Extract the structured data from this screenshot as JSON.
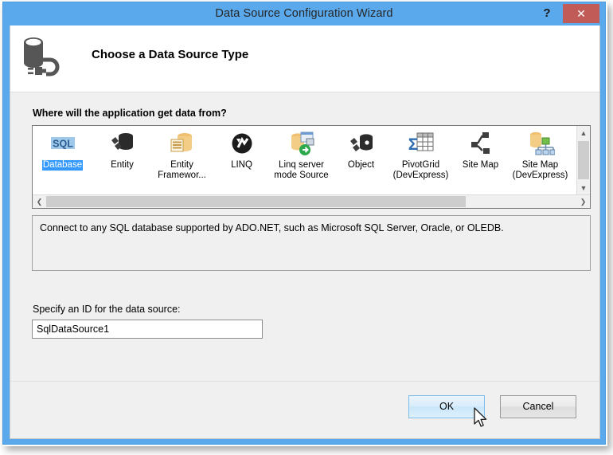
{
  "window": {
    "title": "Data Source Configuration Wizard",
    "help_label": "?",
    "close_label": "✕",
    "titlebar_color": "#5aa9ec",
    "close_color": "#c15b57"
  },
  "header": {
    "title": "Choose a Data Source Type",
    "icon": "database-plug-icon"
  },
  "body": {
    "where_label": "Where will the application get data from?",
    "specify_label": "Specify an ID for the data source:",
    "description": "Connect to any SQL database supported by ADO.NET, such as Microsoft SQL Server, Oracle, or OLEDB.",
    "selection_color": "#3399ff"
  },
  "data_source_types": [
    {
      "label": "Database",
      "icon": "sql-database-icon",
      "selected": true
    },
    {
      "label": "Entity",
      "icon": "entity-icon",
      "selected": false
    },
    {
      "label": "Entity Framewor...",
      "icon": "entity-framework-icon",
      "selected": false
    },
    {
      "label": "LINQ",
      "icon": "linq-icon",
      "selected": false
    },
    {
      "label": "Linq server mode Source",
      "icon": "linq-server-mode-icon",
      "selected": false
    },
    {
      "label": "Object",
      "icon": "object-icon",
      "selected": false
    },
    {
      "label": "PivotGrid (DevExpress)",
      "icon": "pivotgrid-icon",
      "selected": false
    },
    {
      "label": "Site Map",
      "icon": "site-map-icon",
      "selected": false
    },
    {
      "label": "Site Map (DevExpress)",
      "icon": "site-map-devexpress-icon",
      "selected": false
    }
  ],
  "scrollbars": {
    "vertical_up": "▲",
    "vertical_down": "▼",
    "horizontal_left": "❮",
    "horizontal_right": "❯"
  },
  "id_field": {
    "value": "SqlDataSource1",
    "placeholder": ""
  },
  "buttons": {
    "ok_label": "OK",
    "cancel_label": "Cancel"
  }
}
